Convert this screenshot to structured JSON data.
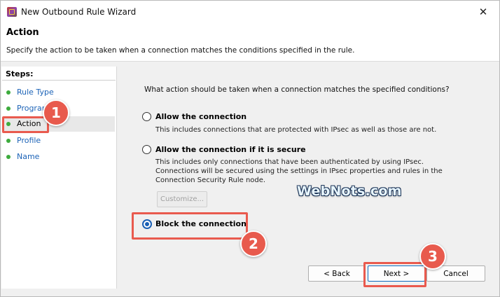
{
  "window": {
    "title": "New Outbound Rule Wizard",
    "close_glyph": "✕"
  },
  "header": {
    "title": "Action",
    "description": "Specify the action to be taken when a connection matches the conditions specified in the rule."
  },
  "sidebar": {
    "steps_label": "Steps:",
    "items": [
      {
        "label": "Rule Type"
      },
      {
        "label": "Program"
      },
      {
        "label": "Action"
      },
      {
        "label": "Profile"
      },
      {
        "label": "Name"
      }
    ],
    "active_index": 2,
    "dot_color": "#3dab3d"
  },
  "content": {
    "question": "What action should be taken when a connection matches the specified conditions?",
    "options": [
      {
        "label": "Allow the connection",
        "description": "This includes connections that are protected with IPsec as well as those are not.",
        "selected": false
      },
      {
        "label": "Allow the connection if it is secure",
        "description": "This includes only connections that have been authenticated by using IPsec.  Connections will be secured using the settings in IPsec properties and rules in the Connection Security Rule node.",
        "selected": false
      },
      {
        "label": "Block the connection",
        "description": "",
        "selected": true
      }
    ],
    "customize_label": "Customize..."
  },
  "buttons": {
    "back": "< Back",
    "next": "Next >",
    "cancel": "Cancel"
  },
  "annotations": {
    "badge_1": "1",
    "badge_2": "2",
    "badge_3": "3",
    "color": "#e85a4d"
  },
  "watermark": "WebNots.com"
}
